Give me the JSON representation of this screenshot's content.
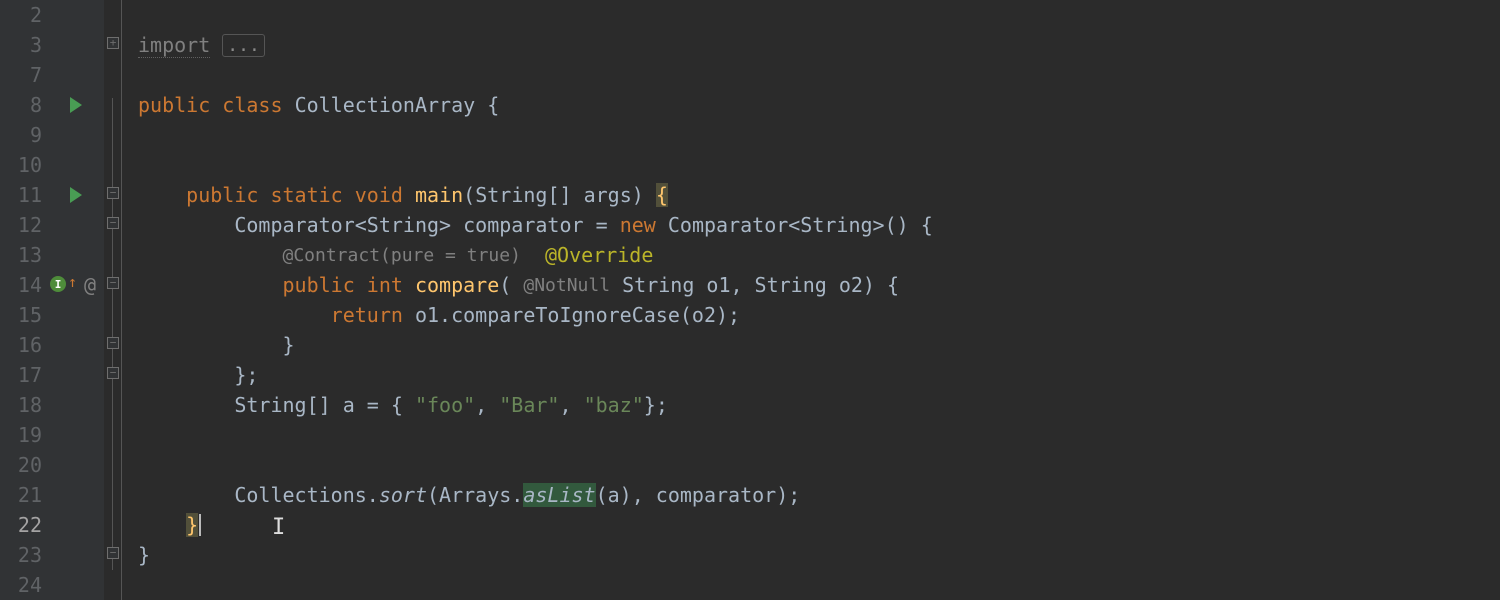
{
  "lines": {
    "2": "2",
    "3": "3",
    "7": "7",
    "8": "8",
    "9": "9",
    "10": "10",
    "11": "11",
    "12": "12",
    "13": "13",
    "14": "14",
    "15": "15",
    "16": "16",
    "17": "17",
    "18": "18",
    "19": "19",
    "20": "20",
    "21": "21",
    "22": "22",
    "23": "23",
    "24": "24"
  },
  "code": {
    "import_kw": "import",
    "import_fold": "...",
    "public": "public",
    "class": "class",
    "className": "CollectionArray",
    "ob": "{",
    "cb": "}",
    "static": "static",
    "void": "void",
    "main": "main",
    "main_params": "(String[] args)",
    "ob_hl": "{",
    "comparator_type": "Comparator<String>",
    "comparator_var": "comparator",
    "eq": "=",
    "new": "new",
    "comparator_new": "Comparator<String>() {",
    "contract": "@Contract(pure = true)",
    "override": "@Override",
    "int": "int",
    "compare": "compare",
    "compare_open": "(",
    "notnull": "@NotNull",
    "compare_rest": "String o1, String o2) {",
    "return": "return",
    "return_expr": "o1.compareToIgnoreCase(o2);",
    "cb_inner": "}",
    "cb_anon": "};",
    "string_arr": "String[] a = {",
    "s_foo": "\"foo\"",
    "s_bar": "\"Bar\"",
    "s_baz": "\"baz\"",
    "arr_close": "};",
    "collections": "Collections.",
    "sort": "sort",
    "sort_open": "(Arrays.",
    "asList": "asList",
    "sort_rest": "(a), comparator);",
    "cb_main": "}",
    "cb_class": "}"
  },
  "gutterIcons": {
    "impl": "I",
    "at": "@"
  }
}
